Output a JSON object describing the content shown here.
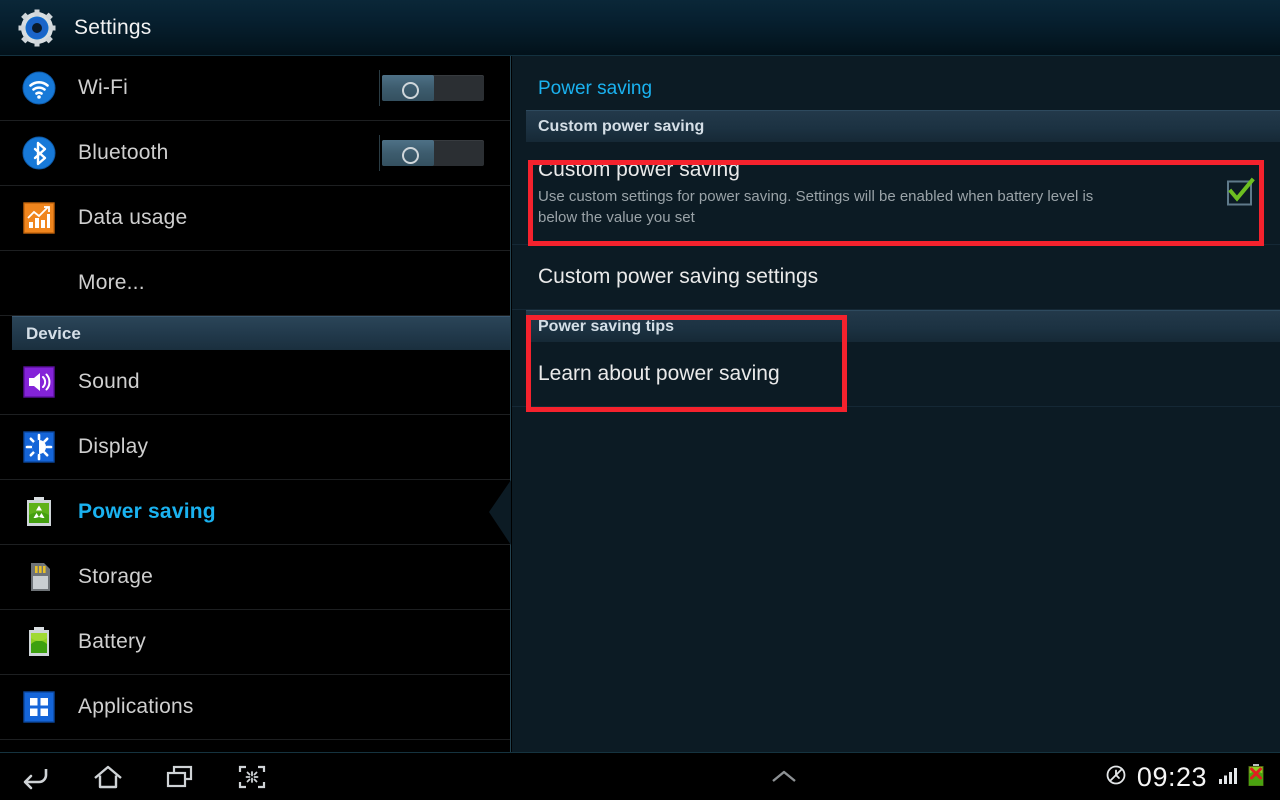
{
  "header": {
    "title": "Settings",
    "icon": "settings-gear-icon"
  },
  "sidebar": {
    "items": [
      {
        "label": "Wi-Fi",
        "icon": "wifi-icon",
        "toggle": "off"
      },
      {
        "label": "Bluetooth",
        "icon": "bluetooth-icon",
        "toggle": "off"
      },
      {
        "label": "Data usage",
        "icon": "data-usage-icon",
        "toggle": null
      },
      {
        "label": "More...",
        "icon": null,
        "toggle": null
      }
    ],
    "section_device": "Device",
    "device_items": [
      {
        "label": "Sound",
        "icon": "sound-speaker-icon",
        "selected": false
      },
      {
        "label": "Display",
        "icon": "display-brightness-icon",
        "selected": false
      },
      {
        "label": "Power saving",
        "icon": "power-saving-recycle-battery-icon",
        "selected": true
      },
      {
        "label": "Storage",
        "icon": "sd-card-icon",
        "selected": false
      },
      {
        "label": "Battery",
        "icon": "battery-icon",
        "selected": false
      },
      {
        "label": "Applications",
        "icon": "applications-grid-icon",
        "selected": false
      }
    ]
  },
  "panel": {
    "title": "Power saving",
    "section_custom": "Custom power saving",
    "custom_toggle": {
      "title": "Custom power saving",
      "summary": "Use custom settings for power saving. Settings will be enabled when battery level is below the value you set",
      "checked": true,
      "checkbox_icon": "checkbox-checked-icon"
    },
    "custom_settings_label": "Custom power saving settings",
    "section_tips": "Power saving tips",
    "learn_label": "Learn about power saving"
  },
  "navbar": {
    "back": "back-icon",
    "home": "home-icon",
    "recents": "recent-apps-icon",
    "screenshot": "screen-capture-icon",
    "expand": "chevron-up-icon",
    "mute": "mute-icon",
    "clock": "09:23",
    "signal": "signal-bars-icon",
    "battery": "battery-error-icon"
  },
  "colors": {
    "accent": "#1ab2f0",
    "annotation": "#f5222d",
    "check": "#6dbf21",
    "panel_bg": "#0c1b24",
    "sidebar_bg": "#000000"
  }
}
